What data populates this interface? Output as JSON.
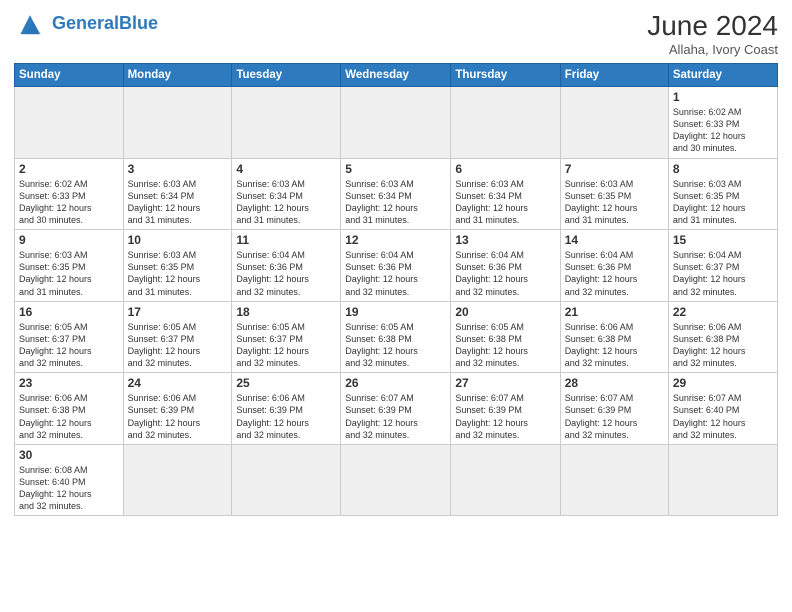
{
  "logo": {
    "general": "General",
    "blue": "Blue"
  },
  "header": {
    "month": "June 2024",
    "location": "Allaha, Ivory Coast"
  },
  "weekdays": [
    "Sunday",
    "Monday",
    "Tuesday",
    "Wednesday",
    "Thursday",
    "Friday",
    "Saturday"
  ],
  "weeks": [
    [
      {
        "day": "",
        "info": ""
      },
      {
        "day": "",
        "info": ""
      },
      {
        "day": "",
        "info": ""
      },
      {
        "day": "",
        "info": ""
      },
      {
        "day": "",
        "info": ""
      },
      {
        "day": "",
        "info": ""
      },
      {
        "day": "1",
        "info": "Sunrise: 6:02 AM\nSunset: 6:33 PM\nDaylight: 12 hours\nand 30 minutes."
      }
    ],
    [
      {
        "day": "2",
        "info": "Sunrise: 6:02 AM\nSunset: 6:33 PM\nDaylight: 12 hours\nand 30 minutes."
      },
      {
        "day": "3",
        "info": "Sunrise: 6:03 AM\nSunset: 6:34 PM\nDaylight: 12 hours\nand 31 minutes."
      },
      {
        "day": "4",
        "info": "Sunrise: 6:03 AM\nSunset: 6:34 PM\nDaylight: 12 hours\nand 31 minutes."
      },
      {
        "day": "5",
        "info": "Sunrise: 6:03 AM\nSunset: 6:34 PM\nDaylight: 12 hours\nand 31 minutes."
      },
      {
        "day": "6",
        "info": "Sunrise: 6:03 AM\nSunset: 6:34 PM\nDaylight: 12 hours\nand 31 minutes."
      },
      {
        "day": "7",
        "info": "Sunrise: 6:03 AM\nSunset: 6:35 PM\nDaylight: 12 hours\nand 31 minutes."
      },
      {
        "day": "8",
        "info": "Sunrise: 6:03 AM\nSunset: 6:35 PM\nDaylight: 12 hours\nand 31 minutes."
      }
    ],
    [
      {
        "day": "9",
        "info": "Sunrise: 6:03 AM\nSunset: 6:35 PM\nDaylight: 12 hours\nand 31 minutes."
      },
      {
        "day": "10",
        "info": "Sunrise: 6:03 AM\nSunset: 6:35 PM\nDaylight: 12 hours\nand 31 minutes."
      },
      {
        "day": "11",
        "info": "Sunrise: 6:04 AM\nSunset: 6:36 PM\nDaylight: 12 hours\nand 32 minutes."
      },
      {
        "day": "12",
        "info": "Sunrise: 6:04 AM\nSunset: 6:36 PM\nDaylight: 12 hours\nand 32 minutes."
      },
      {
        "day": "13",
        "info": "Sunrise: 6:04 AM\nSunset: 6:36 PM\nDaylight: 12 hours\nand 32 minutes."
      },
      {
        "day": "14",
        "info": "Sunrise: 6:04 AM\nSunset: 6:36 PM\nDaylight: 12 hours\nand 32 minutes."
      },
      {
        "day": "15",
        "info": "Sunrise: 6:04 AM\nSunset: 6:37 PM\nDaylight: 12 hours\nand 32 minutes."
      }
    ],
    [
      {
        "day": "16",
        "info": "Sunrise: 6:05 AM\nSunset: 6:37 PM\nDaylight: 12 hours\nand 32 minutes."
      },
      {
        "day": "17",
        "info": "Sunrise: 6:05 AM\nSunset: 6:37 PM\nDaylight: 12 hours\nand 32 minutes."
      },
      {
        "day": "18",
        "info": "Sunrise: 6:05 AM\nSunset: 6:37 PM\nDaylight: 12 hours\nand 32 minutes."
      },
      {
        "day": "19",
        "info": "Sunrise: 6:05 AM\nSunset: 6:38 PM\nDaylight: 12 hours\nand 32 minutes."
      },
      {
        "day": "20",
        "info": "Sunrise: 6:05 AM\nSunset: 6:38 PM\nDaylight: 12 hours\nand 32 minutes."
      },
      {
        "day": "21",
        "info": "Sunrise: 6:06 AM\nSunset: 6:38 PM\nDaylight: 12 hours\nand 32 minutes."
      },
      {
        "day": "22",
        "info": "Sunrise: 6:06 AM\nSunset: 6:38 PM\nDaylight: 12 hours\nand 32 minutes."
      }
    ],
    [
      {
        "day": "23",
        "info": "Sunrise: 6:06 AM\nSunset: 6:38 PM\nDaylight: 12 hours\nand 32 minutes."
      },
      {
        "day": "24",
        "info": "Sunrise: 6:06 AM\nSunset: 6:39 PM\nDaylight: 12 hours\nand 32 minutes."
      },
      {
        "day": "25",
        "info": "Sunrise: 6:06 AM\nSunset: 6:39 PM\nDaylight: 12 hours\nand 32 minutes."
      },
      {
        "day": "26",
        "info": "Sunrise: 6:07 AM\nSunset: 6:39 PM\nDaylight: 12 hours\nand 32 minutes."
      },
      {
        "day": "27",
        "info": "Sunrise: 6:07 AM\nSunset: 6:39 PM\nDaylight: 12 hours\nand 32 minutes."
      },
      {
        "day": "28",
        "info": "Sunrise: 6:07 AM\nSunset: 6:39 PM\nDaylight: 12 hours\nand 32 minutes."
      },
      {
        "day": "29",
        "info": "Sunrise: 6:07 AM\nSunset: 6:40 PM\nDaylight: 12 hours\nand 32 minutes."
      }
    ],
    [
      {
        "day": "30",
        "info": "Sunrise: 6:08 AM\nSunset: 6:40 PM\nDaylight: 12 hours\nand 32 minutes."
      },
      {
        "day": "",
        "info": ""
      },
      {
        "day": "",
        "info": ""
      },
      {
        "day": "",
        "info": ""
      },
      {
        "day": "",
        "info": ""
      },
      {
        "day": "",
        "info": ""
      },
      {
        "day": "",
        "info": ""
      }
    ]
  ]
}
